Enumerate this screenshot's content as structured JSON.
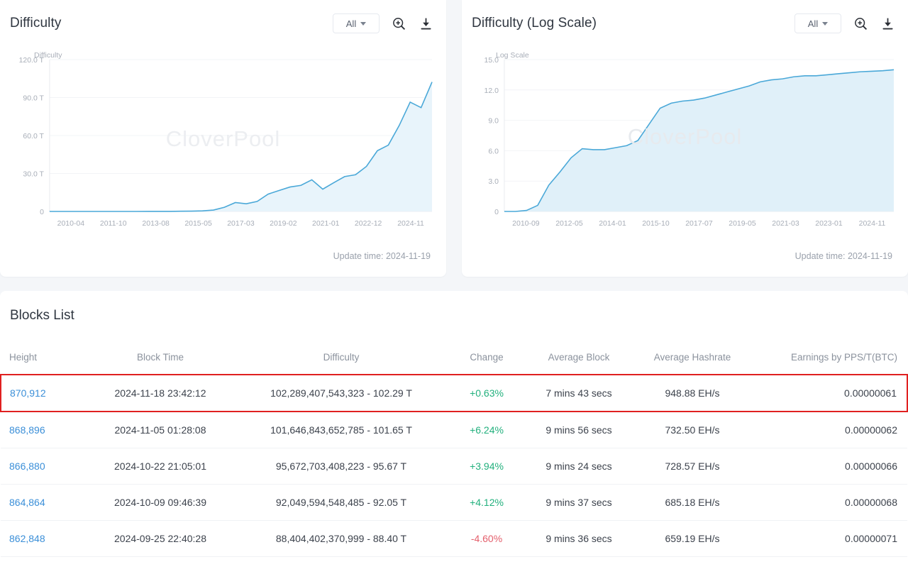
{
  "charts": [
    {
      "title": "Difficulty",
      "axis_label": "Difficulty",
      "range_label": "All",
      "update_time": "Update time: 2024-11-19",
      "watermark": "CloverPool"
    },
    {
      "title": "Difficulty (Log Scale)",
      "axis_label": "Log Scale",
      "range_label": "All",
      "update_time": "Update time: 2024-11-19",
      "watermark": "CloverPool"
    }
  ],
  "chart_data": [
    {
      "type": "area",
      "title": "Difficulty",
      "xlabel": "",
      "ylabel": "Difficulty",
      "ylim": [
        0,
        120
      ],
      "y_unit": "T",
      "yticks": [
        "0",
        "30.0 T",
        "60.0 T",
        "90.0 T",
        "120.0 T"
      ],
      "ytick_values": [
        0,
        30,
        60,
        90,
        120
      ],
      "xticks": [
        "2010-04",
        "2011-10",
        "2013-08",
        "2015-05",
        "2017-03",
        "2019-02",
        "2021-01",
        "2022-12",
        "2024-11"
      ],
      "grid": true,
      "legend": "none",
      "line_color": "#4aa8d8",
      "fill_color": "#e8f4fb",
      "x": [
        "2010-04",
        "2010-10",
        "2011-04",
        "2011-10",
        "2012-04",
        "2012-10",
        "2013-04",
        "2013-10",
        "2014-04",
        "2014-10",
        "2015-04",
        "2015-10",
        "2016-04",
        "2016-10",
        "2017-03",
        "2017-09",
        "2018-03",
        "2018-09",
        "2019-02",
        "2019-06",
        "2019-10",
        "2020-03",
        "2020-09",
        "2021-01",
        "2021-05",
        "2021-08",
        "2021-11",
        "2022-03",
        "2022-07",
        "2022-12",
        "2023-04",
        "2023-08",
        "2023-12",
        "2024-04",
        "2024-07",
        "2024-11"
      ],
      "values": [
        0,
        0,
        0,
        0.001,
        0.003,
        0.003,
        0.01,
        0.27,
        6.1,
        35.0,
        48.0,
        60.0,
        178.0,
        254.0,
        460.0,
        1100.0,
        3290.0,
        7020.0,
        6070.0,
        7930.0,
        13690.0,
        16550.0,
        19300.0,
        20600.0,
        25000.0,
        17600.0,
        22670.0,
        27550.0,
        29000.0,
        35610.0,
        48010.0,
        52390.0,
        67960.0,
        86390.0,
        82050.0,
        102290.0
      ],
      "values_note": "Values are in G (10^9); chart Y axis displays T (10^12). Final point = 102.29 T."
    },
    {
      "type": "area",
      "title": "Difficulty (Log Scale)",
      "xlabel": "",
      "ylabel": "Log Scale",
      "ylim": [
        0,
        15
      ],
      "yticks": [
        "0",
        "3.0",
        "6.0",
        "9.0",
        "12.0",
        "15.0"
      ],
      "ytick_values": [
        0,
        3,
        6,
        9,
        12,
        15
      ],
      "xticks": [
        "2010-09",
        "2012-05",
        "2014-01",
        "2015-10",
        "2017-07",
        "2019-05",
        "2021-03",
        "2023-01",
        "2024-11"
      ],
      "grid": true,
      "legend": "none",
      "line_color": "#4aa8d8",
      "fill_color": "#e0f0f9",
      "x": [
        "2009-01",
        "2009-09",
        "2010-03",
        "2010-09",
        "2011-01",
        "2011-05",
        "2011-09",
        "2012-01",
        "2012-05",
        "2012-09",
        "2013-01",
        "2013-05",
        "2013-09",
        "2014-01",
        "2014-05",
        "2014-09",
        "2015-01",
        "2015-05",
        "2015-10",
        "2016-03",
        "2016-08",
        "2017-01",
        "2017-07",
        "2017-12",
        "2018-05",
        "2018-10",
        "2019-05",
        "2019-11",
        "2020-05",
        "2021-03",
        "2021-09",
        "2022-04",
        "2023-01",
        "2023-08",
        "2024-03",
        "2024-11"
      ],
      "values": [
        0,
        0,
        0.1,
        0.6,
        2.6,
        3.9,
        5.3,
        6.2,
        6.1,
        6.1,
        6.3,
        6.5,
        7.0,
        8.6,
        10.2,
        10.7,
        10.9,
        11.0,
        11.2,
        11.5,
        11.8,
        12.1,
        12.4,
        12.8,
        13.0,
        13.1,
        13.3,
        13.4,
        13.4,
        13.5,
        13.6,
        13.7,
        13.8,
        13.85,
        13.9,
        14.0
      ]
    }
  ],
  "blocks": {
    "title": "Blocks List",
    "columns": [
      "Height",
      "Block Time",
      "Difficulty",
      "Change",
      "Average Block",
      "Average Hashrate",
      "Earnings by PPS/T(BTC)"
    ],
    "rows": [
      {
        "height": "870,912",
        "block_time": "2024-11-18 23:42:12",
        "difficulty": "102,289,407,543,323 - 102.29 T",
        "change": "+0.63%",
        "change_dir": "up",
        "average_block": "7 mins 43 secs",
        "average_hashrate": "948.88 EH/s",
        "earnings": "0.00000061",
        "highlighted": true
      },
      {
        "height": "868,896",
        "block_time": "2024-11-05 01:28:08",
        "difficulty": "101,646,843,652,785 - 101.65 T",
        "change": "+6.24%",
        "change_dir": "up",
        "average_block": "9 mins 56 secs",
        "average_hashrate": "732.50 EH/s",
        "earnings": "0.00000062",
        "highlighted": false
      },
      {
        "height": "866,880",
        "block_time": "2024-10-22 21:05:01",
        "difficulty": "95,672,703,408,223 - 95.67 T",
        "change": "+3.94%",
        "change_dir": "up",
        "average_block": "9 mins 24 secs",
        "average_hashrate": "728.57 EH/s",
        "earnings": "0.00000066",
        "highlighted": false
      },
      {
        "height": "864,864",
        "block_time": "2024-10-09 09:46:39",
        "difficulty": "92,049,594,548,485 - 92.05 T",
        "change": "+4.12%",
        "change_dir": "up",
        "average_block": "9 mins 37 secs",
        "average_hashrate": "685.18 EH/s",
        "earnings": "0.00000068",
        "highlighted": false
      },
      {
        "height": "862,848",
        "block_time": "2024-09-25 22:40:28",
        "difficulty": "88,404,402,370,999 - 88.40 T",
        "change": "-4.60%",
        "change_dir": "down",
        "average_block": "9 mins 36 secs",
        "average_hashrate": "659.19 EH/s",
        "earnings": "0.00000071",
        "highlighted": false
      }
    ]
  },
  "colors": {
    "line": "#4aa8d8",
    "area": "#e8f4fb",
    "link": "#3b8fd8",
    "up": "#22b07d",
    "down": "#e4606d",
    "highlight_border": "#e02020"
  }
}
